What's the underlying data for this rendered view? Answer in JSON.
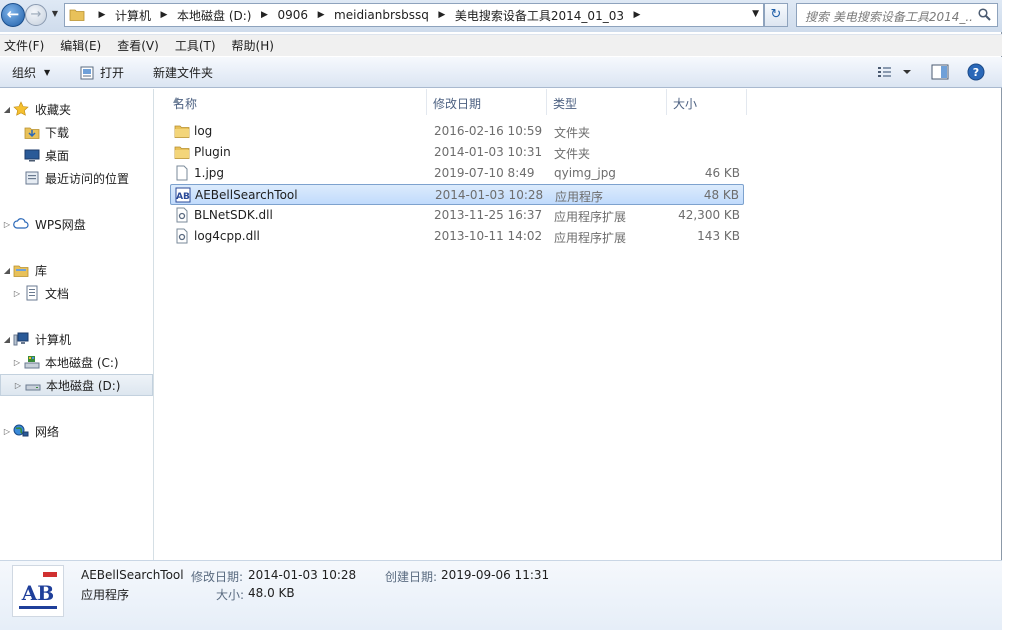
{
  "address": {
    "crumbs": [
      "计算机",
      "本地磁盘 (D:)",
      "0906",
      "meidianbrsbssq",
      "美电搜索设备工具2014_01_03"
    ],
    "search_placeholder": "搜索 美电搜索设备工具2014_..."
  },
  "menu": [
    "文件(F)",
    "编辑(E)",
    "查看(V)",
    "工具(T)",
    "帮助(H)"
  ],
  "toolbar": {
    "organize": "组织",
    "open": "打开",
    "new_folder": "新建文件夹"
  },
  "nav": {
    "favorites": "收藏夹",
    "downloads": "下载",
    "desktop": "桌面",
    "recent": "最近访问的位置",
    "wps": "WPS网盘",
    "library": "库",
    "documents": "文档",
    "computer": "计算机",
    "disk_c": "本地磁盘 (C:)",
    "disk_d": "本地磁盘 (D:)",
    "network": "网络"
  },
  "columns": {
    "name": "名称",
    "modified": "修改日期",
    "type": "类型",
    "size": "大小"
  },
  "files": [
    {
      "name": "log",
      "modified": "2016-02-16 10:59",
      "type": "文件夹",
      "size": "",
      "icon": "folder-icon"
    },
    {
      "name": "Plugin",
      "modified": "2014-01-03 10:31",
      "type": "文件夹",
      "size": "",
      "icon": "folder-icon"
    },
    {
      "name": "1.jpg",
      "modified": "2019-07-10 8:49",
      "type": "qyimg_jpg",
      "size": "46 KB",
      "icon": "blank-file-icon"
    },
    {
      "name": "AEBellSearchTool",
      "modified": "2014-01-03 10:28",
      "type": "应用程序",
      "size": "48 KB",
      "icon": "app-icon"
    },
    {
      "name": "BLNetSDK.dll",
      "modified": "2013-11-25 16:37",
      "type": "应用程序扩展",
      "size": "42,300 KB",
      "icon": "dll-icon"
    },
    {
      "name": "log4cpp.dll",
      "modified": "2013-10-11 14:02",
      "type": "应用程序扩展",
      "size": "143 KB",
      "icon": "dll-icon"
    }
  ],
  "details": {
    "name": "AEBellSearchTool",
    "kind": "应用程序",
    "modified_label": "修改日期:",
    "modified": "2014-01-03 10:28",
    "created_label": "创建日期:",
    "created": "2019-09-06 11:31",
    "size_label": "大小:",
    "size": "48.0 KB"
  },
  "colors": {
    "selection": "#c8dffb",
    "accent": "#1f5fa8",
    "folder": "#e8c15a"
  }
}
